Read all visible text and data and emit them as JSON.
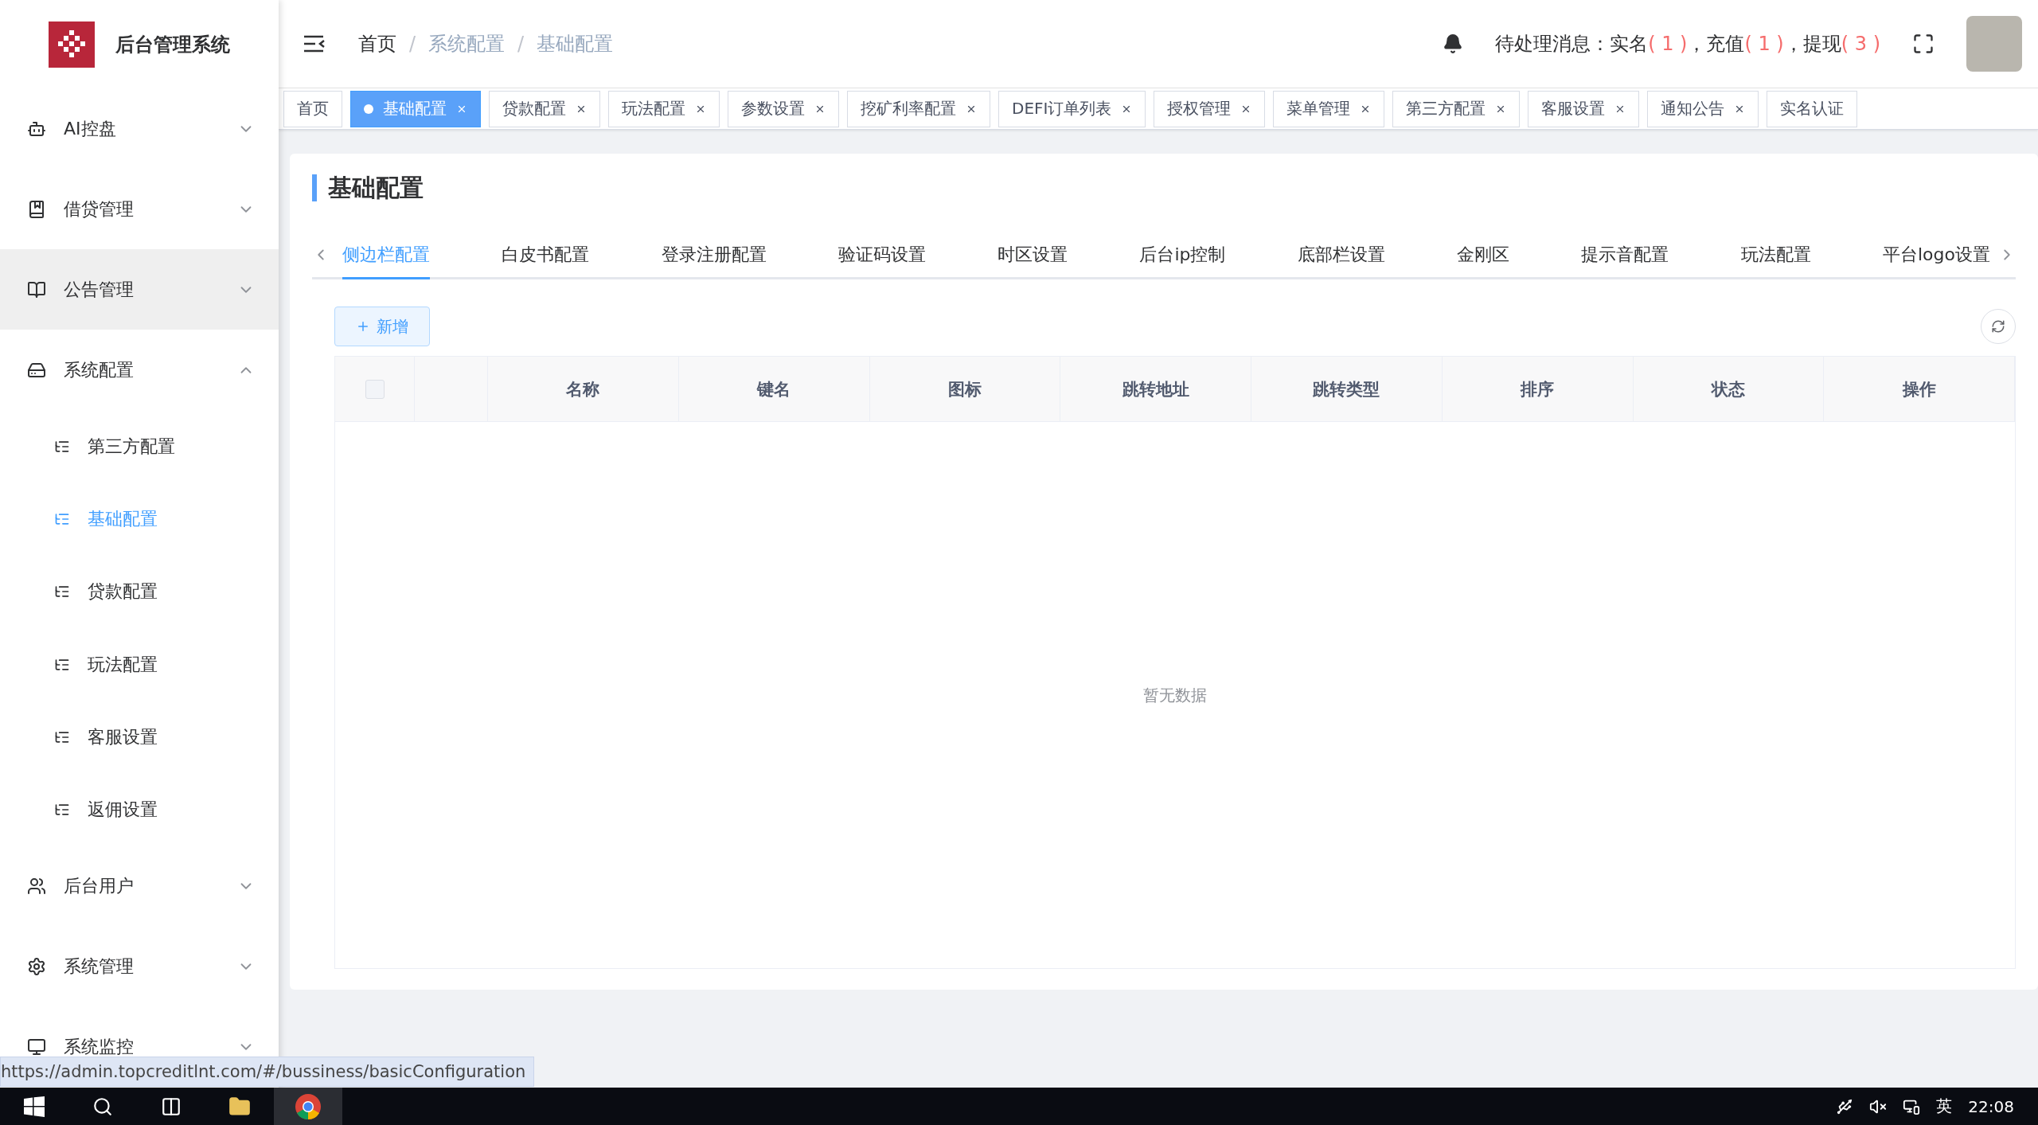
{
  "sidebar": {
    "title": "后台管理系统",
    "items": [
      {
        "label": "AI控盘",
        "expanded": false,
        "hovered": false
      },
      {
        "label": "借贷管理",
        "expanded": false,
        "hovered": false
      },
      {
        "label": "公告管理",
        "expanded": false,
        "hovered": true
      },
      {
        "label": "系统配置",
        "expanded": true,
        "hovered": false,
        "children": [
          {
            "label": "第三方配置",
            "selected": false
          },
          {
            "label": "基础配置",
            "selected": true
          },
          {
            "label": "贷款配置",
            "selected": false
          },
          {
            "label": "玩法配置",
            "selected": false
          },
          {
            "label": "客服设置",
            "selected": false
          },
          {
            "label": "返佣设置",
            "selected": false
          }
        ]
      },
      {
        "label": "后台用户",
        "expanded": false,
        "hovered": false
      },
      {
        "label": "系统管理",
        "expanded": false,
        "hovered": false
      },
      {
        "label": "系统监控",
        "expanded": false,
        "hovered": false
      }
    ]
  },
  "header": {
    "breadcrumb": [
      "首页",
      "系统配置",
      "基础配置"
    ],
    "breadcrumb_separator": "/",
    "message": {
      "prefix": "待处理消息：",
      "items": [
        {
          "label": "实名",
          "count": "( 1 )"
        },
        {
          "label": "，充值",
          "count": "( 1 )"
        },
        {
          "label": "，提现",
          "count": "( 3 )"
        }
      ]
    }
  },
  "tags": [
    {
      "label": "首页",
      "selected": false,
      "closable": false
    },
    {
      "label": "基础配置",
      "selected": true,
      "closable": true
    },
    {
      "label": "贷款配置",
      "selected": false,
      "closable": true
    },
    {
      "label": "玩法配置",
      "selected": false,
      "closable": true
    },
    {
      "label": "参数设置",
      "selected": false,
      "closable": true
    },
    {
      "label": "挖矿利率配置",
      "selected": false,
      "closable": true
    },
    {
      "label": "DEFI订单列表",
      "selected": false,
      "closable": true
    },
    {
      "label": "授权管理",
      "selected": false,
      "closable": true
    },
    {
      "label": "菜单管理",
      "selected": false,
      "closable": true
    },
    {
      "label": "第三方配置",
      "selected": false,
      "closable": true
    },
    {
      "label": "客服设置",
      "selected": false,
      "closable": true
    },
    {
      "label": "通知公告",
      "selected": false,
      "closable": true
    },
    {
      "label": "实名认证",
      "selected": false,
      "closable": false
    }
  ],
  "page": {
    "title": "基础配置",
    "tabs": [
      {
        "label": "侧边栏配置",
        "selected": true
      },
      {
        "label": "白皮书配置",
        "selected": false
      },
      {
        "label": "登录注册配置",
        "selected": false
      },
      {
        "label": "验证码设置",
        "selected": false
      },
      {
        "label": "时区设置",
        "selected": false
      },
      {
        "label": "后台ip控制",
        "selected": false
      },
      {
        "label": "底部栏设置",
        "selected": false
      },
      {
        "label": "金刚区",
        "selected": false
      },
      {
        "label": "提示音配置",
        "selected": false
      },
      {
        "label": "玩法配置",
        "selected": false
      },
      {
        "label": "平台logo设置",
        "selected": false
      }
    ],
    "add_button": "新增",
    "table": {
      "select_all": {
        "checked": false
      },
      "columns": [
        "名称",
        "键名",
        "图标",
        "跳转地址",
        "跳转类型",
        "排序",
        "状态",
        "操作"
      ],
      "empty_text": "暂无数据"
    }
  },
  "status_url": "https://admin.topcreditlnt.com/#/bussiness/basicConfiguration",
  "taskbar": {
    "tray_language": "英",
    "time": "22:08"
  }
}
